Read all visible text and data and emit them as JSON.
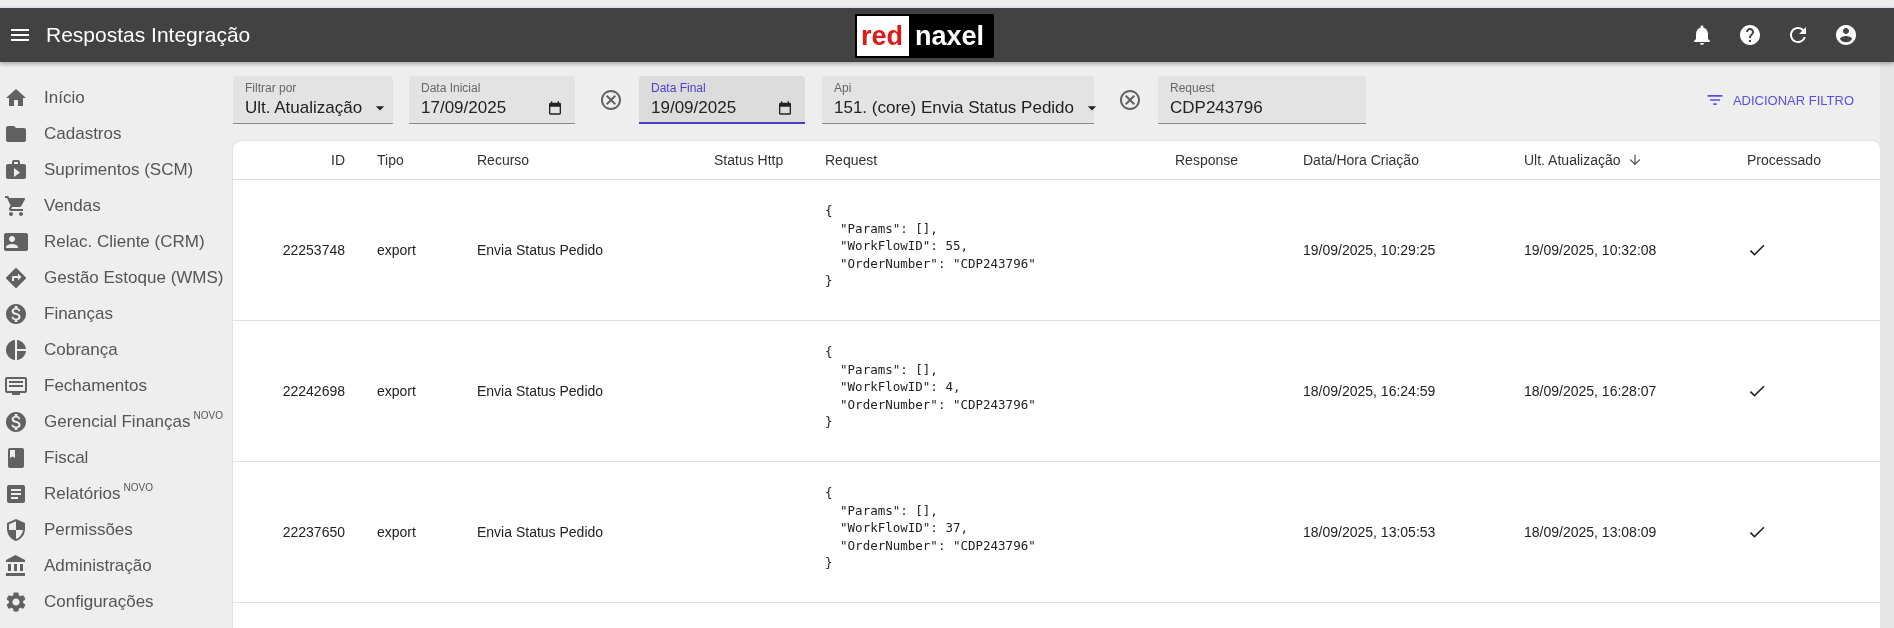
{
  "header": {
    "title": "Respostas Integração",
    "logo": {
      "part_1": "red",
      "part_2": "naxel"
    }
  },
  "sidebar": {
    "items": [
      {
        "label": "Início"
      },
      {
        "label": "Cadastros"
      },
      {
        "label": "Suprimentos (SCM)"
      },
      {
        "label": "Vendas"
      },
      {
        "label": "Relac. Cliente (CRM)"
      },
      {
        "label": "Gestão Estoque (WMS)"
      },
      {
        "label": "Finanças"
      },
      {
        "label": "Cobrança"
      },
      {
        "label": "Fechamentos"
      },
      {
        "label": "Gerencial Finanças",
        "badge": "NOVO"
      },
      {
        "label": "Fiscal"
      },
      {
        "label": "Relatórios",
        "badge": "NOVO"
      },
      {
        "label": "Permissões"
      },
      {
        "label": "Administração"
      },
      {
        "label": "Configurações"
      }
    ]
  },
  "filters": [
    {
      "kind": "select",
      "label": "Filtrar por",
      "value": "Ult. Atualização",
      "focused": false
    },
    {
      "kind": "date",
      "label": "Data Inicial",
      "value": "17/09/2025",
      "focused": false
    },
    {
      "kind": "clear"
    },
    {
      "kind": "date",
      "label": "Data Final",
      "value": "19/09/2025",
      "focused": true
    },
    {
      "kind": "select",
      "label": "Api",
      "value": "151. (core) Envia Status Pedido",
      "focused": false
    },
    {
      "kind": "clear"
    },
    {
      "kind": "text",
      "label": "Request",
      "value": "CDP243796",
      "focused": false
    }
  ],
  "add_filter_button": "ADICIONAR FILTRO",
  "table": {
    "columns": [
      {
        "label": "ID",
        "sorted": false
      },
      {
        "label": "Tipo",
        "sorted": false
      },
      {
        "label": "Recurso",
        "sorted": false
      },
      {
        "label": "Status Http",
        "sorted": false
      },
      {
        "label": "Request",
        "sorted": false
      },
      {
        "label": "Response",
        "sorted": false
      },
      {
        "label": "Data/Hora Criação",
        "sorted": false
      },
      {
        "label": "Ult. Atualização",
        "sorted": true
      },
      {
        "label": "Processado",
        "sorted": false
      }
    ],
    "rows": [
      {
        "id": "22253748",
        "tipo": "export",
        "recurso": "Envia Status Pedido",
        "request": [
          "{",
          "  \"Params\": [],",
          "  \"WorkFlowID\": 55,",
          "  \"OrderNumber\": \"CDP243796\"",
          "}"
        ],
        "created": "19/09/2025, 10:29:25",
        "updated": "19/09/2025, 10:32:08",
        "processed": true
      },
      {
        "id": "22242698",
        "tipo": "export",
        "recurso": "Envia Status Pedido",
        "request": [
          "{",
          "  \"Params\": [],",
          "  \"WorkFlowID\": 4,",
          "  \"OrderNumber\": \"CDP243796\"",
          "}"
        ],
        "created": "18/09/2025, 16:24:59",
        "updated": "18/09/2025, 16:28:07",
        "processed": true
      },
      {
        "id": "22237650",
        "tipo": "export",
        "recurso": "Envia Status Pedido",
        "request": [
          "{",
          "  \"Params\": [],",
          "  \"WorkFlowID\": 37,",
          "  \"OrderNumber\": \"CDP243796\"",
          "}"
        ],
        "created": "18/09/2025, 13:05:53",
        "updated": "18/09/2025, 13:08:09",
        "processed": true
      }
    ]
  }
}
